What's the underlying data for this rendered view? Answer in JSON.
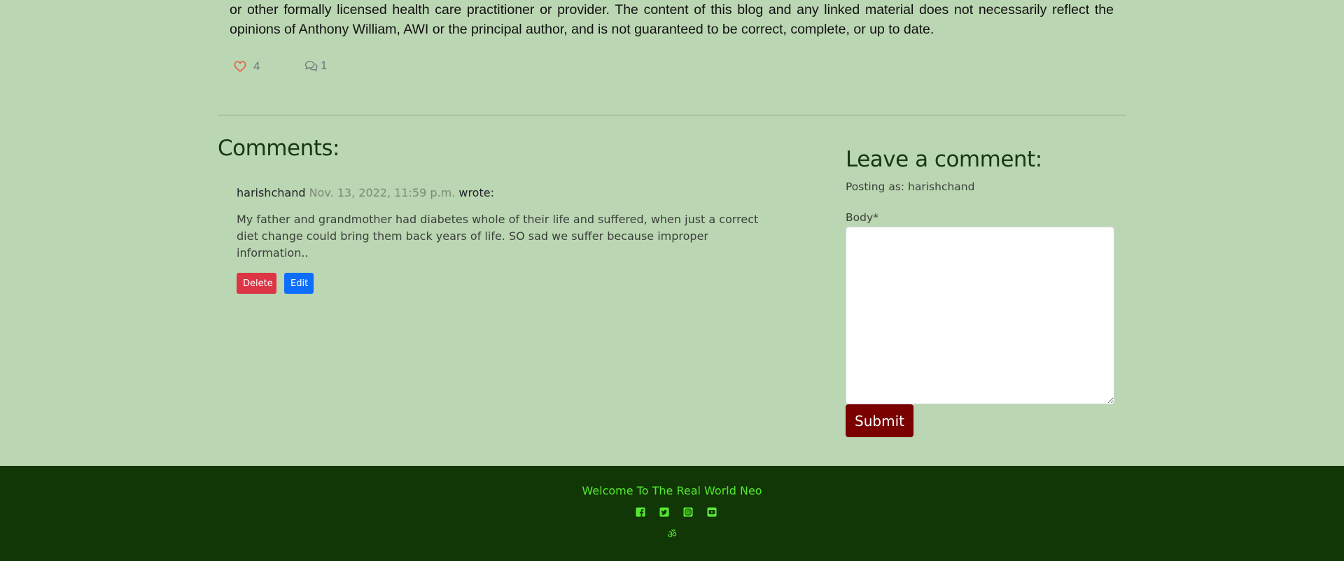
{
  "post": {
    "disclaimer": "or other formally licensed health care practitioner or provider. The content of this blog and any linked material does not necessarily reflect the opinions of Anthony William, AWI or the principal author, and is not guaranteed to be correct, complete, or up to date.",
    "likes": "4",
    "comment_count": "1"
  },
  "comments": {
    "title": "Comments:",
    "items": [
      {
        "author": "harishchand",
        "date": "Nov. 13, 2022, 11:59 p.m.",
        "wrote": "wrote:",
        "body": "My father and grandmother had diabetes whole of their life and suffered, when just a correct diet change could bring them back years of life. SO sad we suffer because improper information..",
        "delete_label": "Delete",
        "edit_label": "Edit"
      }
    ]
  },
  "comment_form": {
    "title": "Leave a comment:",
    "posting_as": "Posting as: harishchand",
    "body_label": "Body*",
    "body_value": "",
    "submit_label": "Submit"
  },
  "footer": {
    "text": "Welcome To The Real World Neo",
    "icons": [
      "facebook-icon",
      "twitter-icon",
      "instagram-icon",
      "youtube-icon"
    ],
    "om_symbol": "ॐ"
  },
  "colors": {
    "page_bg": "#bbd6b2",
    "footer_bg": "#103705",
    "footer_accent": "#56e833",
    "heart": "#e35d3f",
    "delete": "#dc3545",
    "edit": "#0d6efd",
    "submit": "#7a0000"
  }
}
